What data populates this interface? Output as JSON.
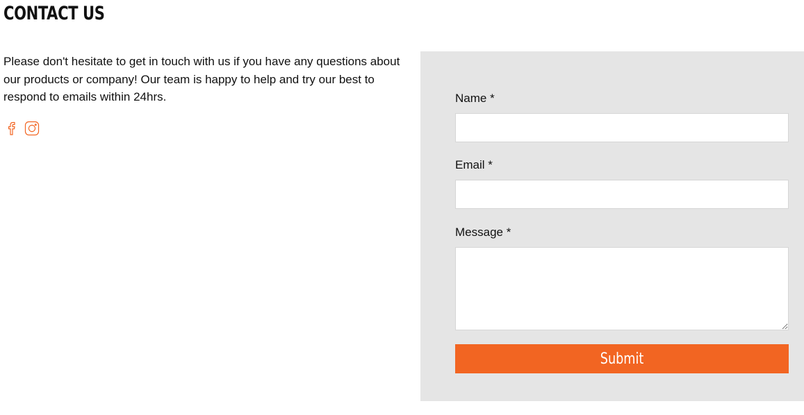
{
  "page": {
    "title": "CONTACT US",
    "intro": "Please don't hesitate to get in touch with us if you have any questions about our products or company! Our team is happy to help and try our best to respond to emails within 24hrs."
  },
  "social": {
    "icons": [
      "facebook-icon",
      "instagram-icon"
    ],
    "icon_color": "#f26522"
  },
  "form": {
    "name_label": "Name *",
    "name_value": "",
    "email_label": "Email *",
    "email_value": "",
    "message_label": "Message *",
    "message_value": "",
    "submit_label": "Submit",
    "panel_color": "#e5e5e5",
    "button_color": "#f26522"
  }
}
